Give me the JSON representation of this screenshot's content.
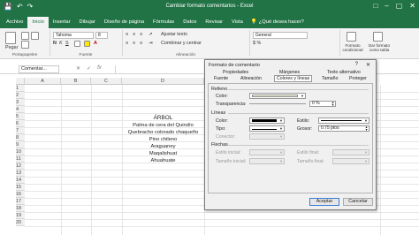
{
  "window": {
    "title": "Cambiar formato comentarios - Excel",
    "quick_access": [
      "save-icon",
      "undo-icon",
      "redo-icon"
    ],
    "controls": [
      "ribbon-display-icon",
      "minimize-icon",
      "maximize-icon",
      "close-icon"
    ]
  },
  "tabs": [
    "Archivo",
    "Inicio",
    "Insertar",
    "Dibujar",
    "Diseño de página",
    "Fórmulas",
    "Datos",
    "Revisar",
    "Vista"
  ],
  "active_tab": "Inicio",
  "tell_me": "¿Qué desea hacer?",
  "ribbon": {
    "paste_label": "Pegar",
    "clipboard_label": "Portapapeles",
    "font_name": "Tahoma",
    "font_size": "8",
    "font_group_label": "Fuente",
    "align_group_label": "Alineación",
    "wrap_text": "Ajustar texto",
    "merge_center": "Combinar y centrar",
    "number_format": "General",
    "cond_format": "Formato condicional",
    "table_format": "Dar formato como tabla"
  },
  "formula_bar": {
    "name_box": "Comentar...",
    "cancel_symbol": "✕",
    "enter_symbol": "✓",
    "fx_symbol": "fx"
  },
  "grid": {
    "columns": [
      "A",
      "B",
      "C",
      "D"
    ],
    "rows": [
      "1",
      "2",
      "3",
      "4",
      "5",
      "6",
      "7",
      "8",
      "9",
      "10",
      "11",
      "12",
      "13",
      "14",
      "15",
      "16",
      "17",
      "18",
      "19",
      "20"
    ],
    "header_cell": "ÁRBOL",
    "tree_list": [
      "Palma de cera del Quindío",
      "Quebracho colorado chaqueño",
      "Pino chileno",
      "Araguaney",
      "Maqalishuat",
      "Ahuahuate"
    ]
  },
  "dialog": {
    "title": "Formato de comentario",
    "help": "?",
    "close": "✕",
    "tabs_row1": [
      "Propiedades",
      "Márgenes",
      "Texto alternativo"
    ],
    "tabs_row2": [
      "Fuente",
      "Alineación",
      "Colores y líneas",
      "Tamaño",
      "Proteger"
    ],
    "active_tab": "Colores y líneas",
    "fill_section": "Relleno",
    "fill_color_label": "Color:",
    "transparency_label": "Transparencia:",
    "transparency_value": "0 %",
    "lines_section": "Líneas",
    "line_color_label": "Color:",
    "line_style_label": "Estilo:",
    "line_type_label": "Tipo:",
    "line_weight_label": "Grosor:",
    "line_weight_value": "0.75 ptos",
    "connector_label": "Conector:",
    "arrows_section": "Flechas",
    "begin_style_label": "Estilo inicial:",
    "end_style_label": "Estilo final:",
    "begin_size_label": "Tamaño inicial:",
    "end_size_label": "Tamaño final:",
    "ok_label": "Aceptar",
    "cancel_label": "Cancelar"
  },
  "colors": {
    "excel_green": "#217346",
    "fill_color": "#ffffe1",
    "line_color": "#000000"
  }
}
